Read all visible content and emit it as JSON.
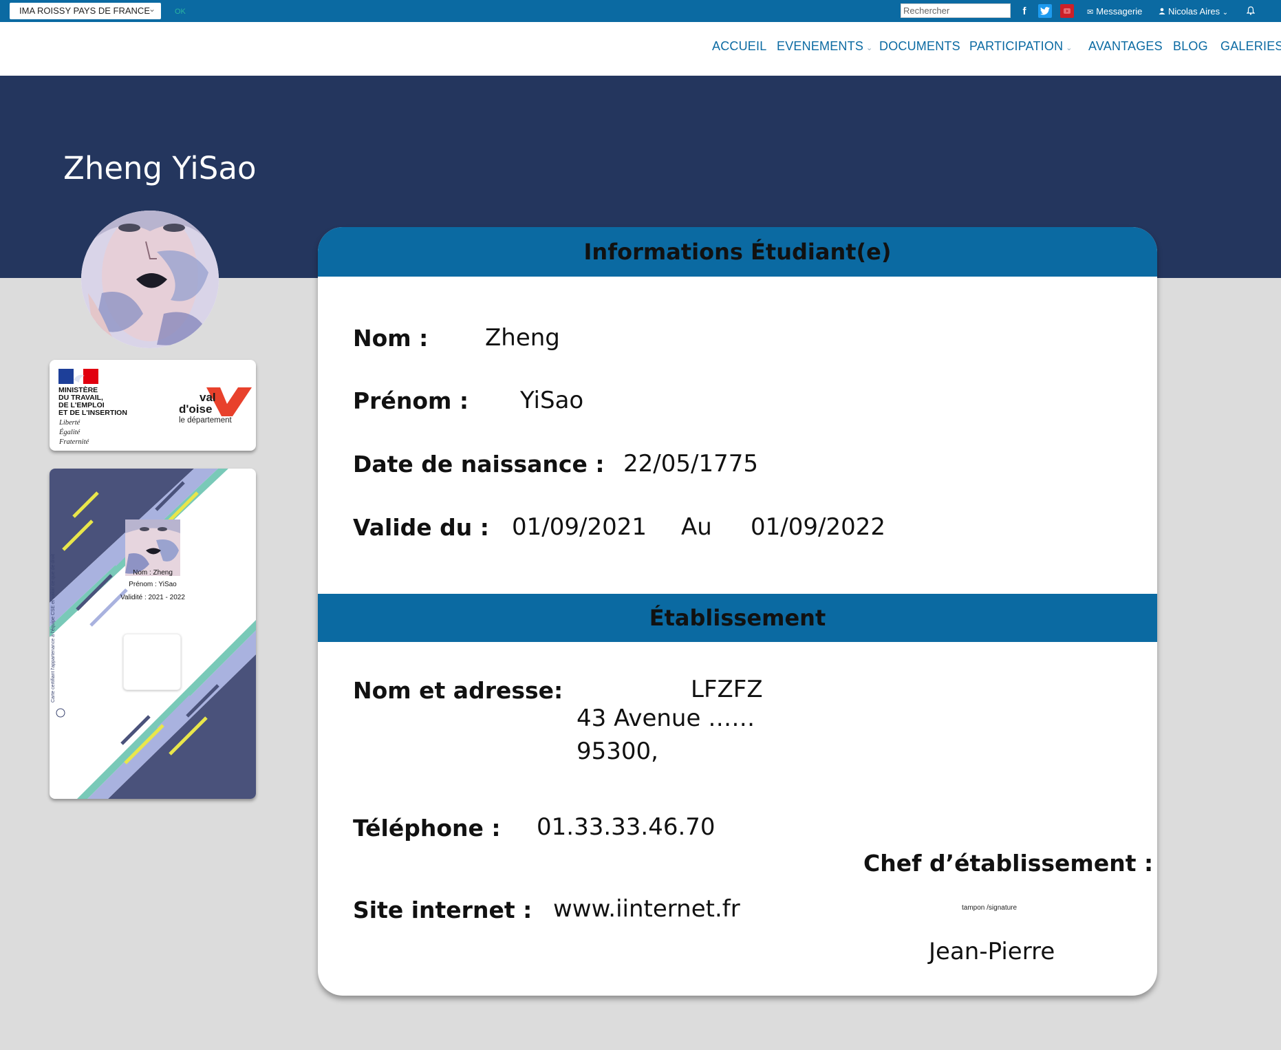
{
  "topbar": {
    "site_selector": "IMA ROISSY PAYS DE FRANCE",
    "ok_label": "OK",
    "search_placeholder": "Rechercher",
    "messages_label": "Messagerie",
    "user_name": "Nicolas Aires"
  },
  "nav": {
    "items": [
      {
        "label": "ACCUEIL"
      },
      {
        "label": "EVENEMENTS"
      },
      {
        "label": "DOCUMENTS"
      },
      {
        "label": "PARTICIPATION"
      },
      {
        "label": "AVANTAGES"
      },
      {
        "label": "BLOG"
      },
      {
        "label": "GALERIES"
      }
    ]
  },
  "page": {
    "title": "Zheng YiSao"
  },
  "logos": {
    "ministry": [
      "MINISTÈRE",
      "DU TRAVAIL,",
      "DE L'EMPLOI",
      "ET DE L'INSERTION"
    ],
    "motto": [
      "Liberté",
      "Égalité",
      "Fraternité"
    ],
    "valdoise_line1": "val",
    "valdoise_line2": "d'oise",
    "valdoise_sub": "le département"
  },
  "card_preview": {
    "name": "Nom : Zheng",
    "first_name": "Prénom : YiSao",
    "validity": "Validité : 2021 - 2022",
    "vertical_text": "Carte certifiant l'appartenance à l'équipe CSE et valoir ce que de droit"
  },
  "student_section": {
    "title": "Informations Étudiant(e)",
    "nom_label": "Nom :",
    "nom_value": "Zheng",
    "prenom_label": "Prénom :",
    "prenom_value": "YiSao",
    "dob_label": "Date de naissance :",
    "dob_value": "22/05/1775",
    "valid_label": "Valide du :",
    "valid_from": "01/09/2021",
    "valid_to_label": "Au",
    "valid_to": "01/09/2022"
  },
  "establishment_section": {
    "title": "Établissement",
    "address_label": "Nom et adresse:",
    "name_value": "LFZFZ",
    "address_line1": "43 Avenue ……",
    "address_line2": "95300,",
    "phone_label": "Téléphone :",
    "phone_value": "01.33.33.46.70",
    "website_label": "Site internet :",
    "website_value": "www.iinternet.fr",
    "chef_label": "Chef d’établissement :",
    "stamp_note": "tampon /signature",
    "chef_name": "Jean-Pierre"
  },
  "colors": {
    "topbar": "#0b6aa2",
    "hero": "#24365e",
    "section_header": "#0b6aa2",
    "nav_text": "#0b6aa2",
    "page_bg": "#dcdcdc",
    "valdoise_red": "#e8412c"
  },
  "icons": [
    "chevron-down-icon",
    "facebook-icon",
    "twitter-icon",
    "youtube-icon",
    "envelope-icon",
    "user-icon",
    "bell-icon"
  ]
}
